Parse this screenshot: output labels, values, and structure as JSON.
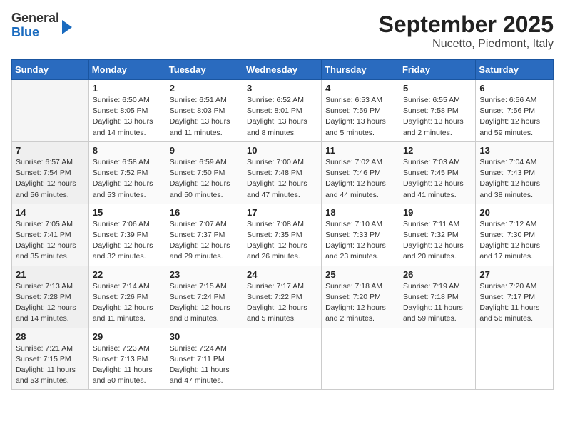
{
  "header": {
    "logo_general": "General",
    "logo_blue": "Blue",
    "title": "September 2025",
    "subtitle": "Nucetto, Piedmont, Italy"
  },
  "columns": [
    "Sunday",
    "Monday",
    "Tuesday",
    "Wednesday",
    "Thursday",
    "Friday",
    "Saturday"
  ],
  "weeks": [
    [
      {
        "day": "",
        "sunrise": "",
        "sunset": "",
        "daylight": ""
      },
      {
        "day": "1",
        "sunrise": "Sunrise: 6:50 AM",
        "sunset": "Sunset: 8:05 PM",
        "daylight": "Daylight: 13 hours and 14 minutes."
      },
      {
        "day": "2",
        "sunrise": "Sunrise: 6:51 AM",
        "sunset": "Sunset: 8:03 PM",
        "daylight": "Daylight: 13 hours and 11 minutes."
      },
      {
        "day": "3",
        "sunrise": "Sunrise: 6:52 AM",
        "sunset": "Sunset: 8:01 PM",
        "daylight": "Daylight: 13 hours and 8 minutes."
      },
      {
        "day": "4",
        "sunrise": "Sunrise: 6:53 AM",
        "sunset": "Sunset: 7:59 PM",
        "daylight": "Daylight: 13 hours and 5 minutes."
      },
      {
        "day": "5",
        "sunrise": "Sunrise: 6:55 AM",
        "sunset": "Sunset: 7:58 PM",
        "daylight": "Daylight: 13 hours and 2 minutes."
      },
      {
        "day": "6",
        "sunrise": "Sunrise: 6:56 AM",
        "sunset": "Sunset: 7:56 PM",
        "daylight": "Daylight: 12 hours and 59 minutes."
      }
    ],
    [
      {
        "day": "7",
        "sunrise": "Sunrise: 6:57 AM",
        "sunset": "Sunset: 7:54 PM",
        "daylight": "Daylight: 12 hours and 56 minutes."
      },
      {
        "day": "8",
        "sunrise": "Sunrise: 6:58 AM",
        "sunset": "Sunset: 7:52 PM",
        "daylight": "Daylight: 12 hours and 53 minutes."
      },
      {
        "day": "9",
        "sunrise": "Sunrise: 6:59 AM",
        "sunset": "Sunset: 7:50 PM",
        "daylight": "Daylight: 12 hours and 50 minutes."
      },
      {
        "day": "10",
        "sunrise": "Sunrise: 7:00 AM",
        "sunset": "Sunset: 7:48 PM",
        "daylight": "Daylight: 12 hours and 47 minutes."
      },
      {
        "day": "11",
        "sunrise": "Sunrise: 7:02 AM",
        "sunset": "Sunset: 7:46 PM",
        "daylight": "Daylight: 12 hours and 44 minutes."
      },
      {
        "day": "12",
        "sunrise": "Sunrise: 7:03 AM",
        "sunset": "Sunset: 7:45 PM",
        "daylight": "Daylight: 12 hours and 41 minutes."
      },
      {
        "day": "13",
        "sunrise": "Sunrise: 7:04 AM",
        "sunset": "Sunset: 7:43 PM",
        "daylight": "Daylight: 12 hours and 38 minutes."
      }
    ],
    [
      {
        "day": "14",
        "sunrise": "Sunrise: 7:05 AM",
        "sunset": "Sunset: 7:41 PM",
        "daylight": "Daylight: 12 hours and 35 minutes."
      },
      {
        "day": "15",
        "sunrise": "Sunrise: 7:06 AM",
        "sunset": "Sunset: 7:39 PM",
        "daylight": "Daylight: 12 hours and 32 minutes."
      },
      {
        "day": "16",
        "sunrise": "Sunrise: 7:07 AM",
        "sunset": "Sunset: 7:37 PM",
        "daylight": "Daylight: 12 hours and 29 minutes."
      },
      {
        "day": "17",
        "sunrise": "Sunrise: 7:08 AM",
        "sunset": "Sunset: 7:35 PM",
        "daylight": "Daylight: 12 hours and 26 minutes."
      },
      {
        "day": "18",
        "sunrise": "Sunrise: 7:10 AM",
        "sunset": "Sunset: 7:33 PM",
        "daylight": "Daylight: 12 hours and 23 minutes."
      },
      {
        "day": "19",
        "sunrise": "Sunrise: 7:11 AM",
        "sunset": "Sunset: 7:32 PM",
        "daylight": "Daylight: 12 hours and 20 minutes."
      },
      {
        "day": "20",
        "sunrise": "Sunrise: 7:12 AM",
        "sunset": "Sunset: 7:30 PM",
        "daylight": "Daylight: 12 hours and 17 minutes."
      }
    ],
    [
      {
        "day": "21",
        "sunrise": "Sunrise: 7:13 AM",
        "sunset": "Sunset: 7:28 PM",
        "daylight": "Daylight: 12 hours and 14 minutes."
      },
      {
        "day": "22",
        "sunrise": "Sunrise: 7:14 AM",
        "sunset": "Sunset: 7:26 PM",
        "daylight": "Daylight: 12 hours and 11 minutes."
      },
      {
        "day": "23",
        "sunrise": "Sunrise: 7:15 AM",
        "sunset": "Sunset: 7:24 PM",
        "daylight": "Daylight: 12 hours and 8 minutes."
      },
      {
        "day": "24",
        "sunrise": "Sunrise: 7:17 AM",
        "sunset": "Sunset: 7:22 PM",
        "daylight": "Daylight: 12 hours and 5 minutes."
      },
      {
        "day": "25",
        "sunrise": "Sunrise: 7:18 AM",
        "sunset": "Sunset: 7:20 PM",
        "daylight": "Daylight: 12 hours and 2 minutes."
      },
      {
        "day": "26",
        "sunrise": "Sunrise: 7:19 AM",
        "sunset": "Sunset: 7:18 PM",
        "daylight": "Daylight: 11 hours and 59 minutes."
      },
      {
        "day": "27",
        "sunrise": "Sunrise: 7:20 AM",
        "sunset": "Sunset: 7:17 PM",
        "daylight": "Daylight: 11 hours and 56 minutes."
      }
    ],
    [
      {
        "day": "28",
        "sunrise": "Sunrise: 7:21 AM",
        "sunset": "Sunset: 7:15 PM",
        "daylight": "Daylight: 11 hours and 53 minutes."
      },
      {
        "day": "29",
        "sunrise": "Sunrise: 7:23 AM",
        "sunset": "Sunset: 7:13 PM",
        "daylight": "Daylight: 11 hours and 50 minutes."
      },
      {
        "day": "30",
        "sunrise": "Sunrise: 7:24 AM",
        "sunset": "Sunset: 7:11 PM",
        "daylight": "Daylight: 11 hours and 47 minutes."
      },
      {
        "day": "",
        "sunrise": "",
        "sunset": "",
        "daylight": ""
      },
      {
        "day": "",
        "sunrise": "",
        "sunset": "",
        "daylight": ""
      },
      {
        "day": "",
        "sunrise": "",
        "sunset": "",
        "daylight": ""
      },
      {
        "day": "",
        "sunrise": "",
        "sunset": "",
        "daylight": ""
      }
    ]
  ]
}
